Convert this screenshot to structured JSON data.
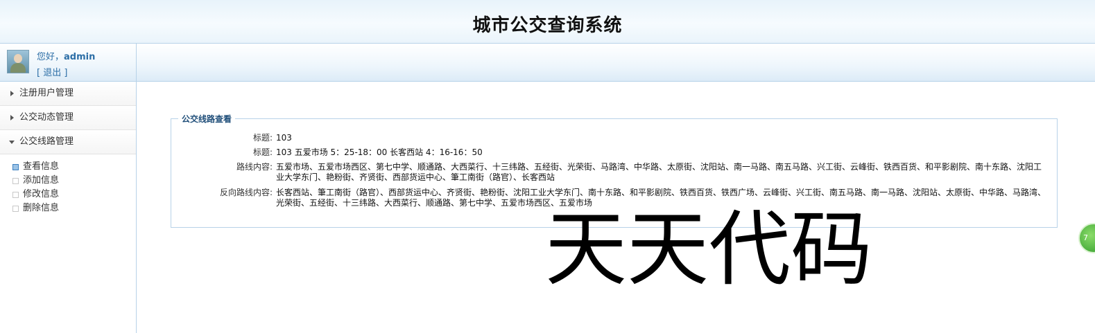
{
  "header": {
    "title": "城市公交查询系统"
  },
  "user": {
    "greeting": "您好，",
    "name": "admin",
    "logout": "[ 退出 ]"
  },
  "sidebar": {
    "menus": [
      {
        "label": "注册用户管理",
        "expanded": false
      },
      {
        "label": "公交动态管理",
        "expanded": false
      },
      {
        "label": "公交线路管理",
        "expanded": true
      }
    ],
    "submenu": [
      {
        "label": "查看信息",
        "active": true
      },
      {
        "label": "添加信息",
        "active": false
      },
      {
        "label": "修改信息",
        "active": false
      },
      {
        "label": "删除信息",
        "active": false
      }
    ]
  },
  "panel": {
    "legend": "公交线路查看",
    "rows": [
      {
        "label": "标题:",
        "value": "103"
      },
      {
        "label": "标题:",
        "value": "103 五爱市场 5：25-18：00 长客西站 4：16-16：50"
      },
      {
        "label": "路线内容:",
        "value": "五爱市场、五爱市场西区、第七中学、顺通路、大西菜行、十三纬路、五经街、光荣街、马路湾、中华路、太原街、沈阳站、南一马路、南五马路、兴工街、云峰街、铁西百货、和平影剧院、南十东路、沈阳工业大学东门、艳粉街、齐贤街、西部货运中心、筆工南街（路官）、长客西站"
      },
      {
        "label": "反向路线内容:",
        "value": "长客西站、筆工南街（路官）、西部货运中心、齐贤街、艳粉街、沈阳工业大学东门、南十东路、和平影剧院、铁西百货、铁西广场、云峰街、兴工街、南五马路、南一马路、沈阳站、太原街、中华路、马路湾、光荣街、五经街、十三纬路、大西菜行、顺通路、第七中学、五爱市场西区、五爱市场"
      }
    ]
  },
  "watermark": {
    "text": "天天代码"
  },
  "floating_button": {
    "label": "7"
  }
}
